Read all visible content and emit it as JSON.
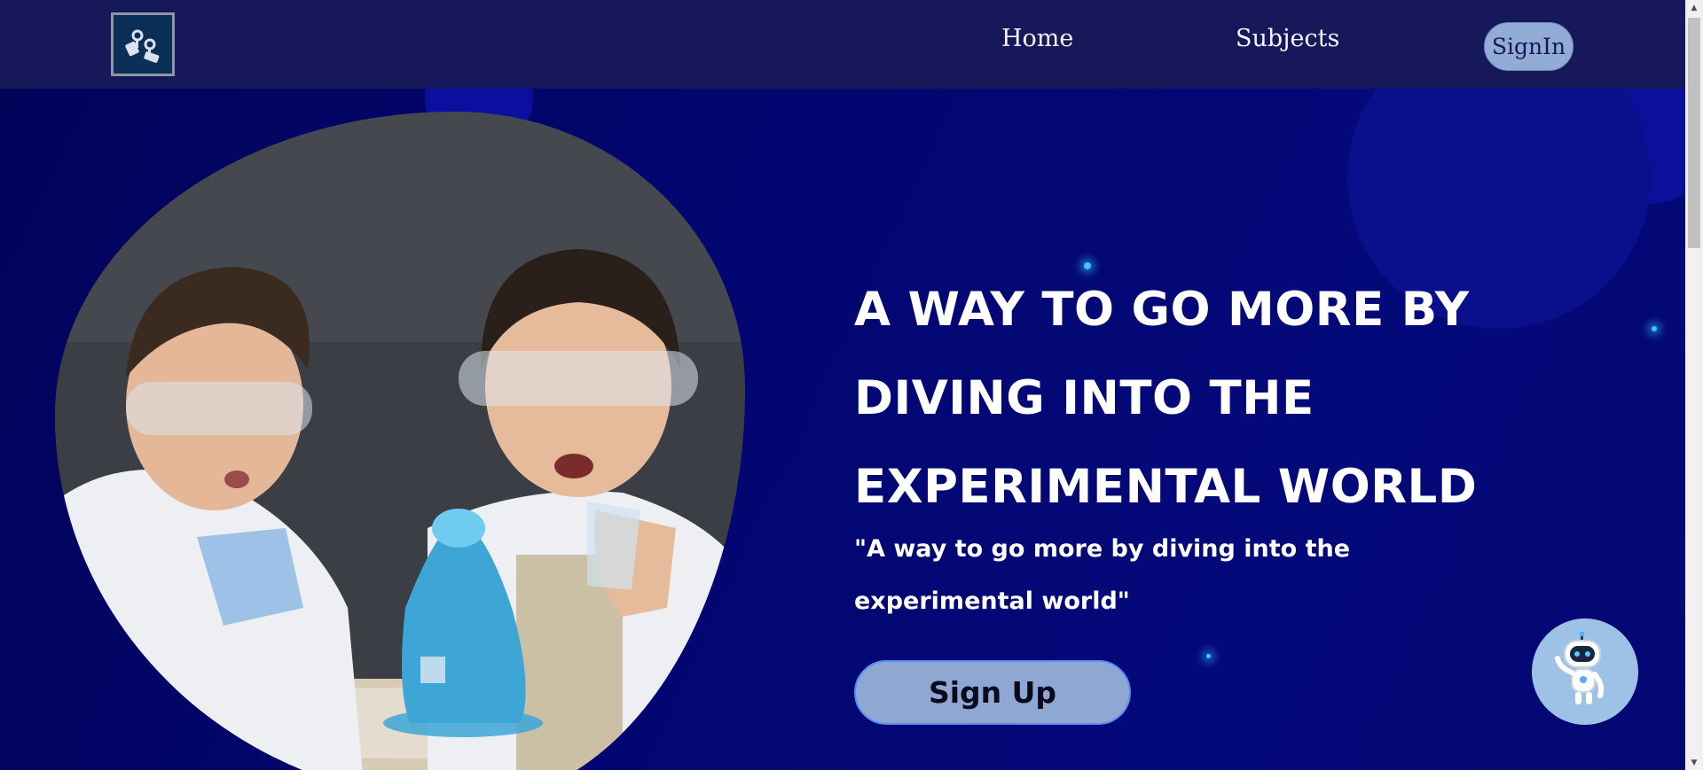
{
  "nav": {
    "logo_icon": "lab-tools-icon",
    "home": "Home",
    "subjects": "Subjects",
    "signin": "SignIn"
  },
  "hero": {
    "image_alt": "children-doing-science-experiment",
    "headline": "A WAY TO GO MORE BY DIVING INTO THE EXPERIMENTAL WORLD",
    "subline": "\"A way to go more by diving into the experimental world\"",
    "signup": "Sign Up"
  },
  "chatbot": {
    "icon": "robot-icon"
  },
  "colors": {
    "navbar": "#16185a",
    "hero_bg": "#02046e",
    "button": "#8fa8d3",
    "accent_glow": "#38c8ff"
  }
}
